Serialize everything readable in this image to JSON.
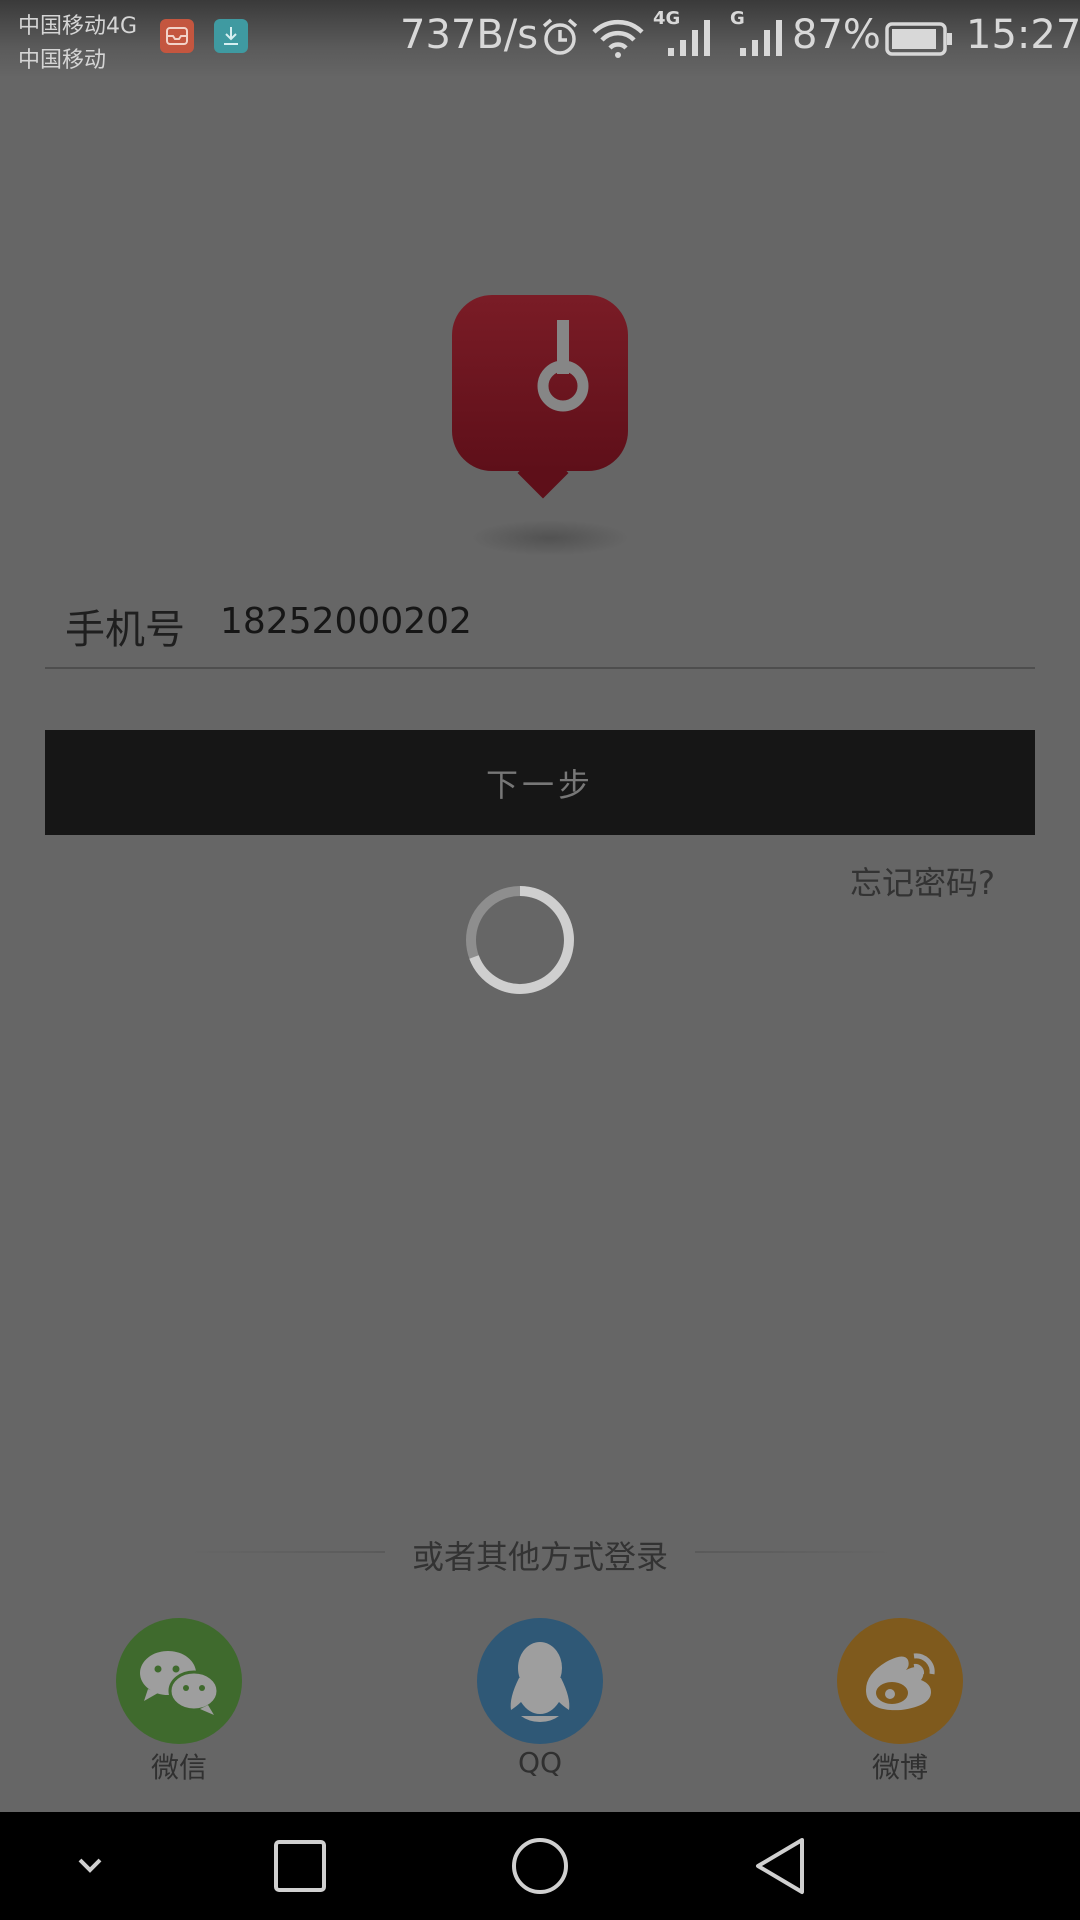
{
  "status_bar": {
    "carrier_line1": "中国移动4G",
    "carrier_line2": "中国移动",
    "net_speed": "737B/s",
    "signal1_label": "4G",
    "signal2_label": "G",
    "battery_percent": "87%",
    "time": "15:27",
    "icons": [
      "mail-notification-icon",
      "download-notification-icon",
      "alarm-icon",
      "wifi-icon",
      "signal-icon",
      "battery-icon"
    ]
  },
  "login": {
    "phone_label": "手机号",
    "phone_value": "18252000202",
    "next_button": "下一步",
    "forgot_password": "忘记密码?"
  },
  "other_login": {
    "divider_text": "或者其他方式登录",
    "options": [
      {
        "label": "微信",
        "icon": "wechat-icon",
        "color": "#3f6a2d"
      },
      {
        "label": "QQ",
        "icon": "qq-icon",
        "color": "#2f5876"
      },
      {
        "label": "微博",
        "icon": "weibo-icon",
        "color": "#7f5a1d"
      }
    ]
  },
  "colors": {
    "overlay_background": "#666666",
    "logo_red": "#6e1520",
    "button_dark": "#161616"
  },
  "nav_bar": {
    "icons": [
      "collapse-icon",
      "recents-icon",
      "home-icon",
      "back-icon"
    ]
  }
}
